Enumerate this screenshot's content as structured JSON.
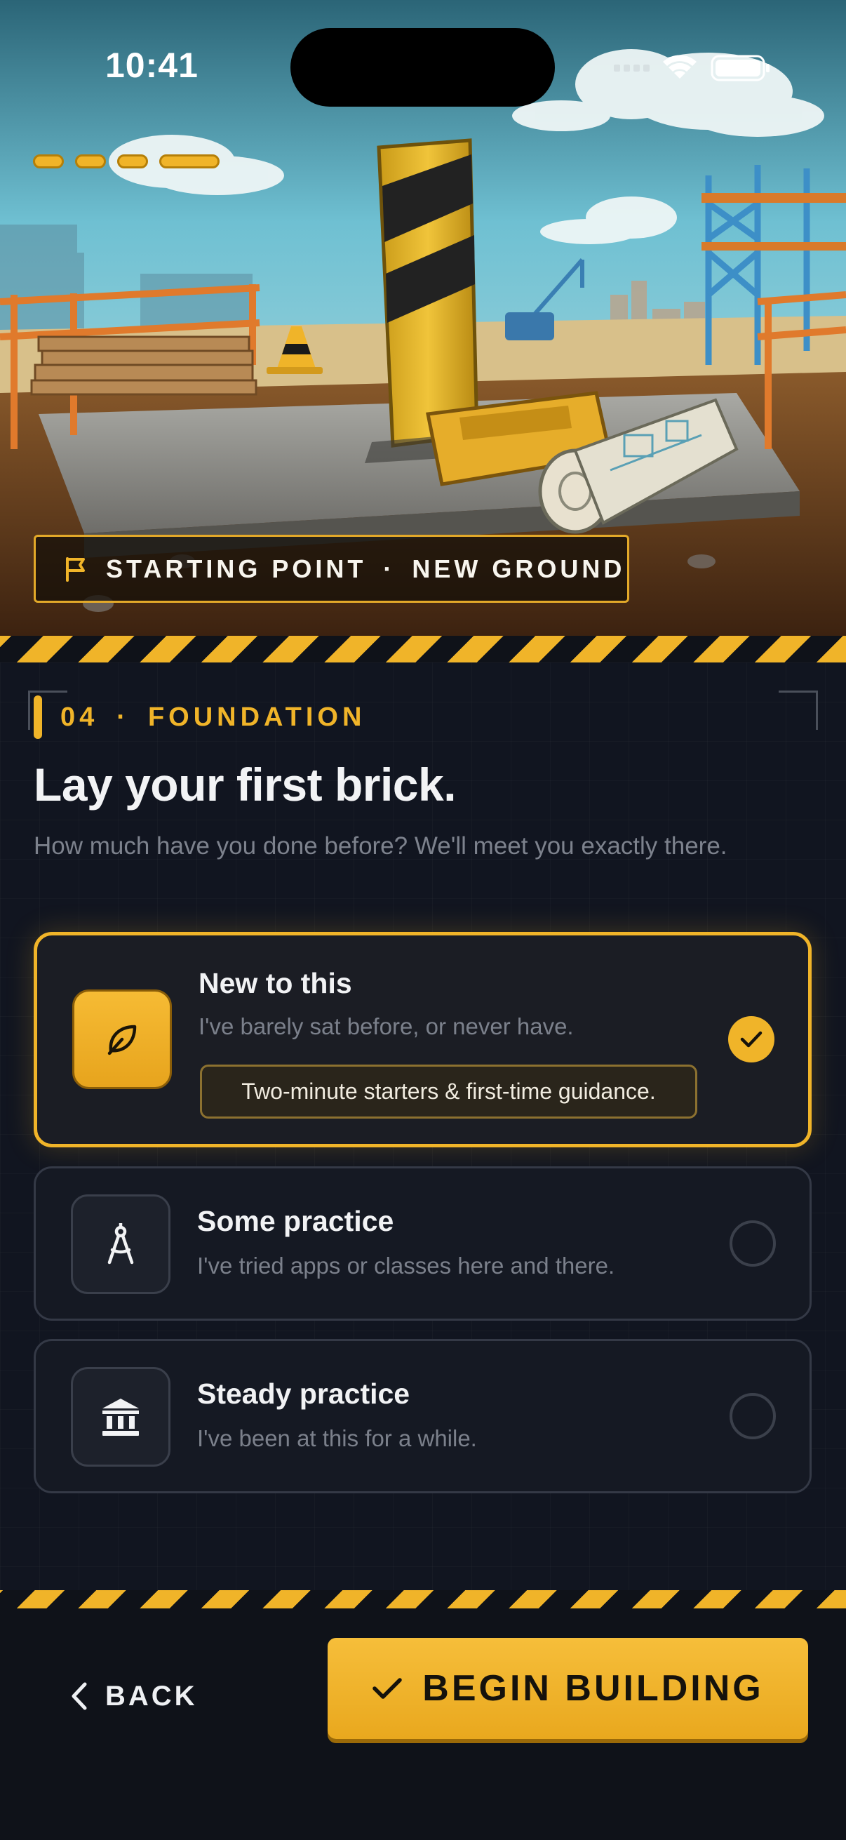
{
  "status_bar": {
    "time": "10:41"
  },
  "onboarding_progress": {
    "segments_total": 4,
    "current_segment": 4
  },
  "hero": {
    "tag_part1": "STARTING POINT",
    "tag_separator": "·",
    "tag_part2": "NEW GROUND",
    "tag_icon": "flag-icon"
  },
  "step": {
    "number": "04",
    "separator": "·",
    "label": "FOUNDATION"
  },
  "title": "Lay your first brick.",
  "subtitle": "How much have you done before? We'll meet you exactly there.",
  "options": [
    {
      "title": "New to this",
      "description": "I've barely sat before, or never have.",
      "note": "Two-minute starters & first-time guidance.",
      "icon": "leaf-icon",
      "selected": true
    },
    {
      "title": "Some practice",
      "description": "I've tried apps or classes here and there.",
      "icon": "compass-icon",
      "selected": false
    },
    {
      "title": "Steady practice",
      "description": "I've been at this for a while.",
      "icon": "bank-icon",
      "selected": false
    }
  ],
  "footer": {
    "back_label": "BACK",
    "cta_label": "BEGIN BUILDING"
  },
  "colors": {
    "accent": "#f0b429",
    "background": "#111520",
    "text_muted": "#7d828d"
  }
}
